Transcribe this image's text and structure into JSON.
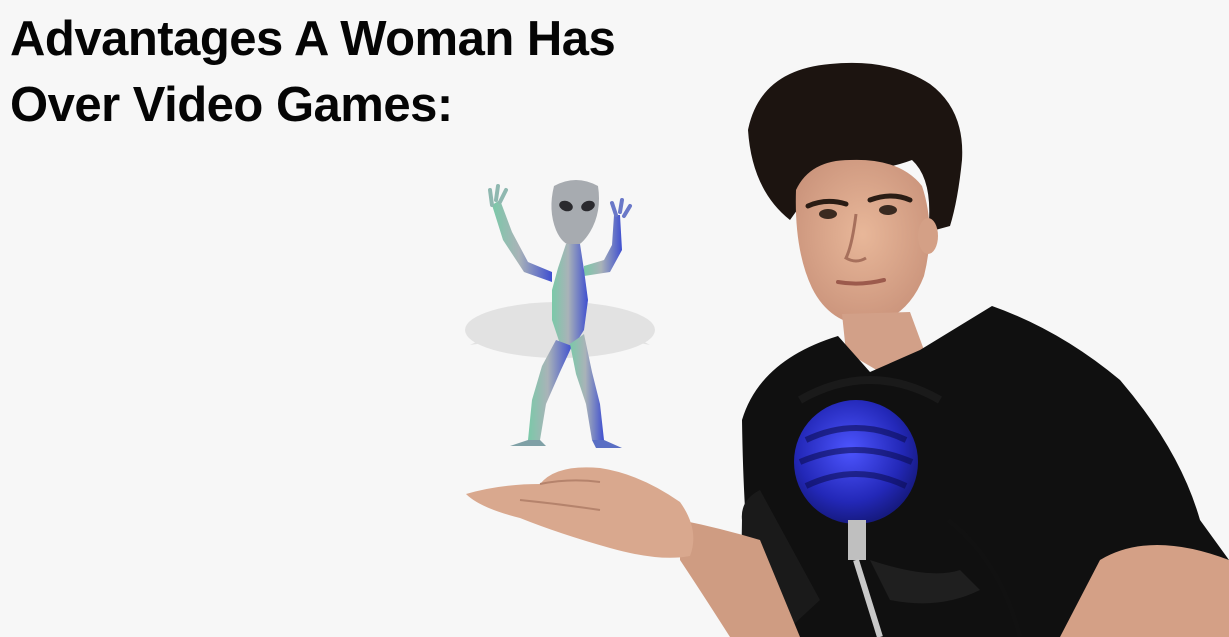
{
  "title": {
    "line1": "Advantages A Woman Has",
    "line2": "Over Video Games:"
  }
}
